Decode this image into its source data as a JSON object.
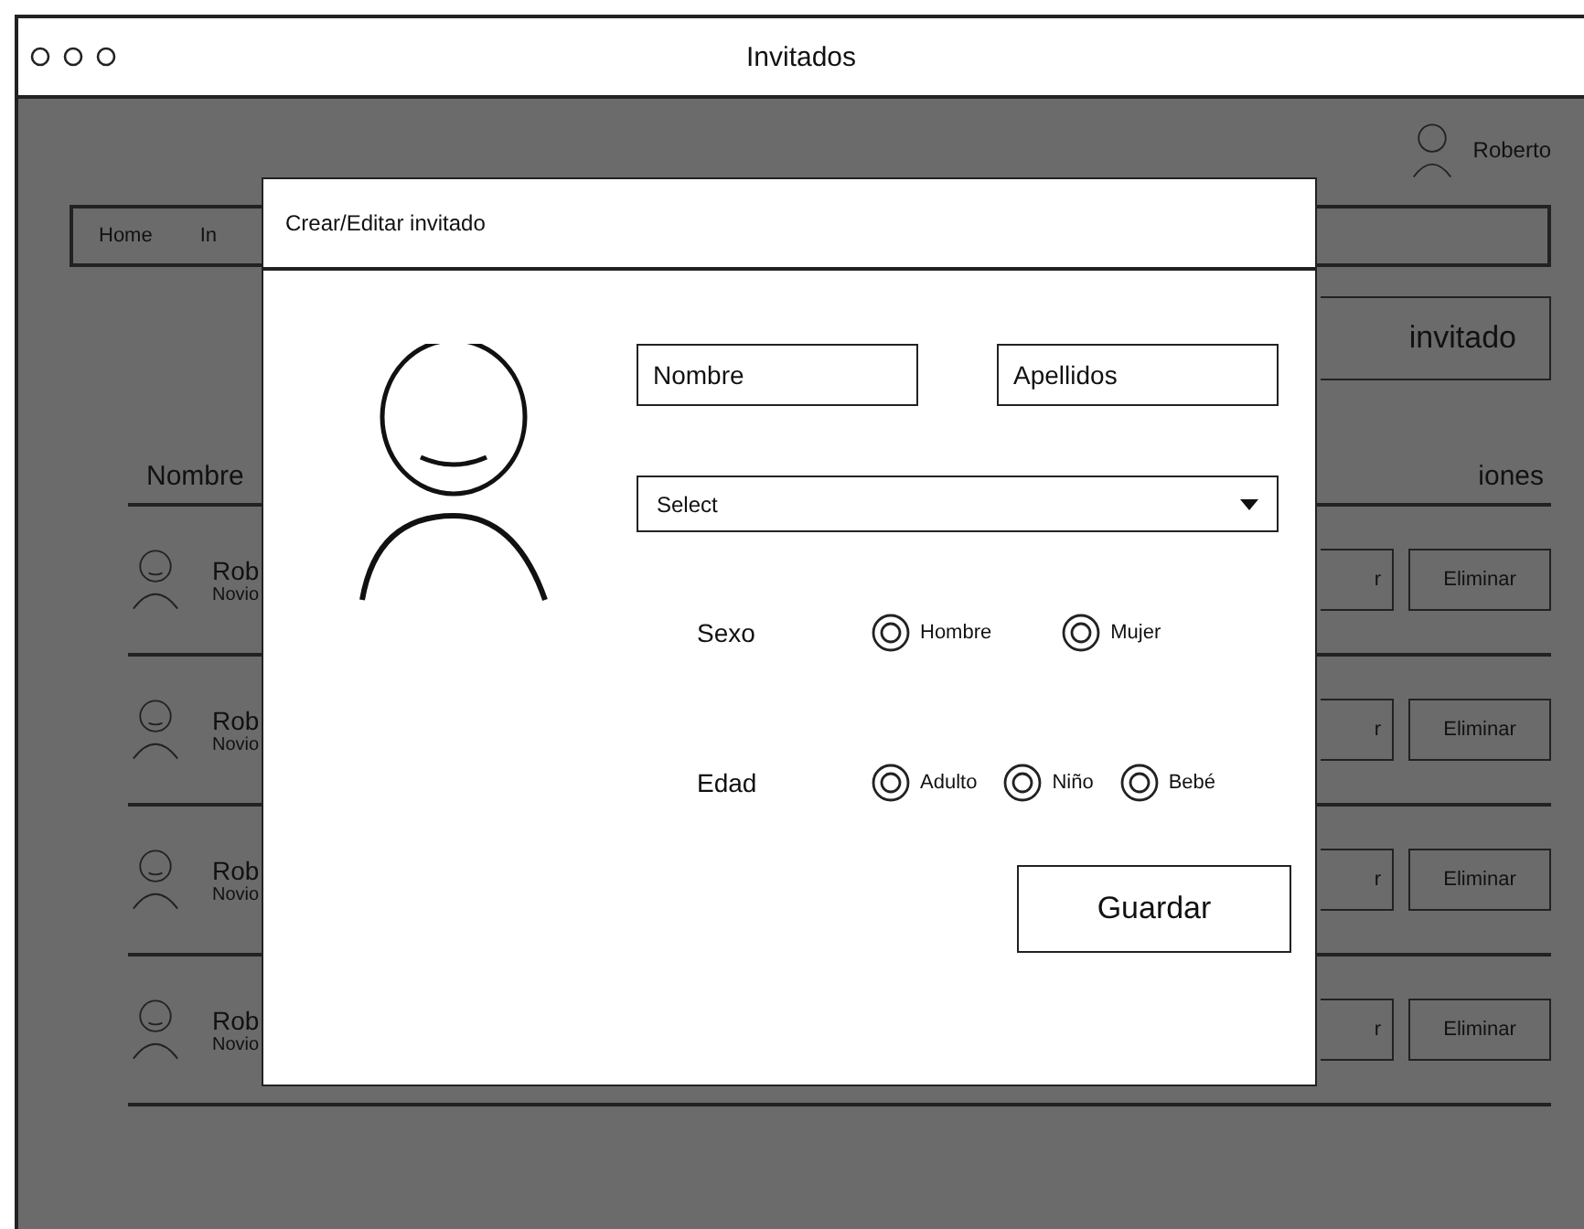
{
  "window": {
    "title": "Invitados"
  },
  "user": {
    "name": "Roberto"
  },
  "nav": {
    "items": [
      {
        "label": "Home"
      },
      {
        "label": "In"
      }
    ]
  },
  "add_button": {
    "label": "invitado"
  },
  "table": {
    "columns": [
      "Nombre",
      "iones"
    ],
    "rows": [
      {
        "name": "Rob",
        "role": "Novio",
        "edit": "r",
        "delete": "Eliminar"
      },
      {
        "name": "Rob",
        "role": "Novio",
        "edit": "r",
        "delete": "Eliminar"
      },
      {
        "name": "Rob",
        "role": "Novio",
        "edit": "r",
        "delete": "Eliminar"
      },
      {
        "name": "Rob",
        "role": "Novio",
        "edit": "r",
        "delete": "Eliminar"
      }
    ]
  },
  "dialog": {
    "title": "Crear/Editar invitado",
    "fields": [
      {
        "placeholder": "Nombre"
      },
      {
        "placeholder": "Apellidos"
      }
    ],
    "select": {
      "value": "Select"
    },
    "groups": [
      {
        "label": "Sexo",
        "options": [
          {
            "label": "Hombre",
            "selected": false
          },
          {
            "label": "Mujer",
            "selected": false
          }
        ]
      },
      {
        "label": "Edad",
        "options": [
          {
            "label": "Adulto",
            "selected": false
          },
          {
            "label": "Niño",
            "selected": false
          },
          {
            "label": "Bebé",
            "selected": false
          }
        ]
      }
    ],
    "save_button": "Guardar"
  }
}
